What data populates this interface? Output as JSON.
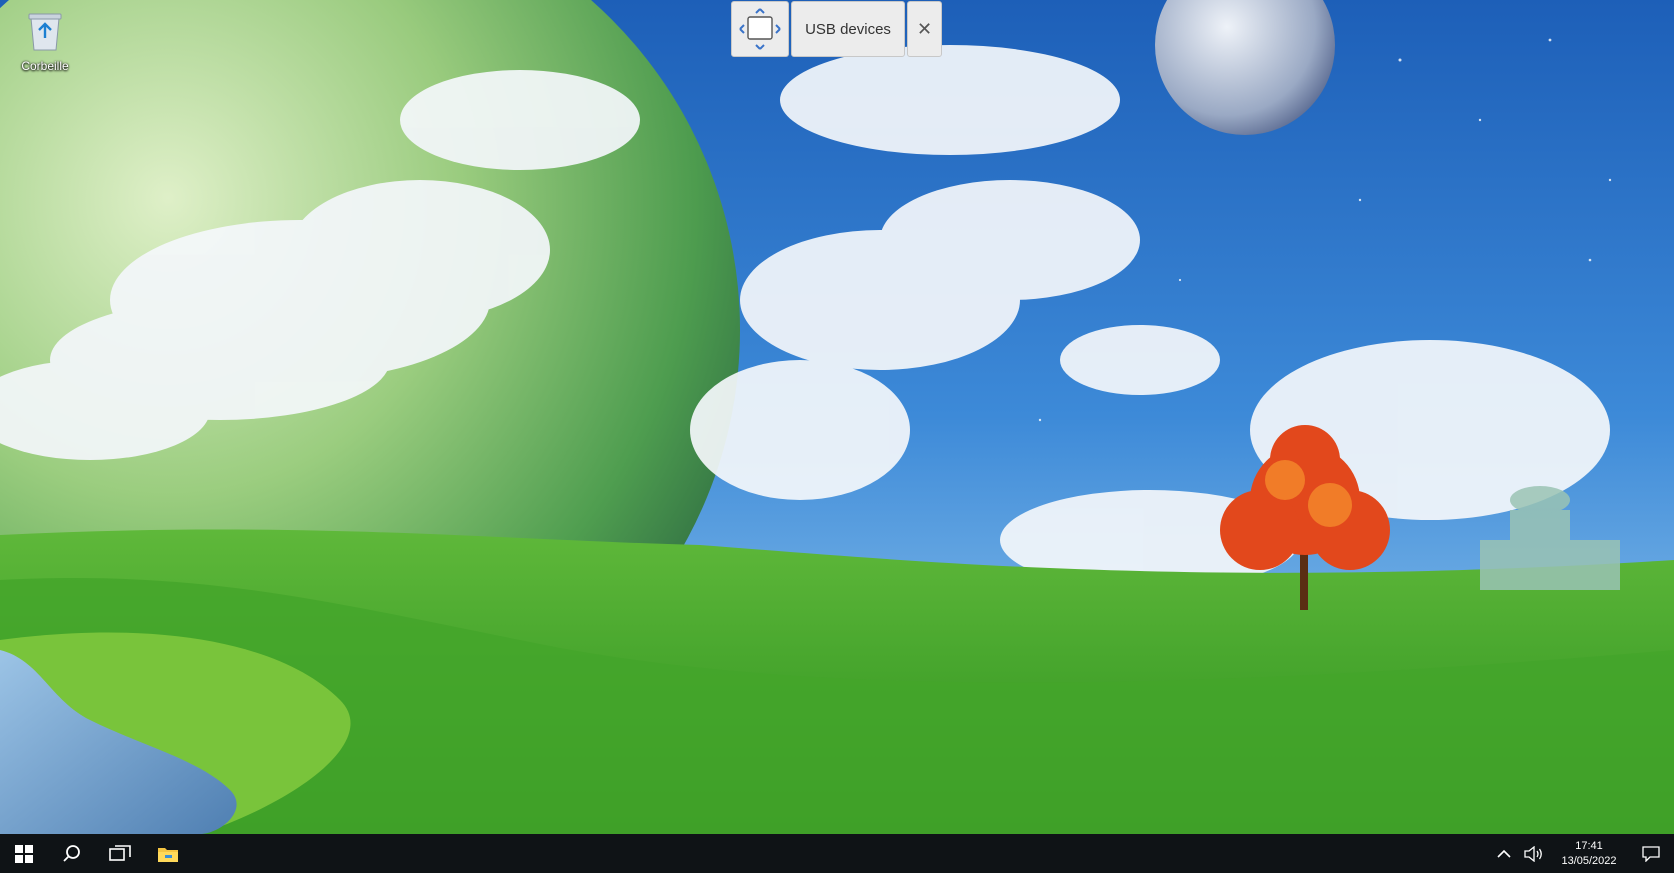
{
  "desktop": {
    "icons": [
      {
        "label": "Corbeille",
        "icon": "recycle-bin-icon"
      }
    ]
  },
  "usb_toolbar": {
    "label": "USB devices",
    "move_icon": "window-move-icon",
    "close_glyph": "✕"
  },
  "taskbar": {
    "start_icon": "windows-start-icon",
    "search_icon": "search-icon",
    "taskview_icon": "task-view-icon",
    "pinned": [
      {
        "icon": "file-explorer-icon"
      }
    ],
    "tray": {
      "chevron_icon": "chevron-up-icon",
      "volume_icon": "volume-icon",
      "time": "17:41",
      "date": "13/05/2022",
      "notification_icon": "notification-icon"
    }
  },
  "colors": {
    "taskbar_bg": "#0f1316",
    "toolbar_bg": "#ececec",
    "accent_blue": "#3a73c9"
  }
}
